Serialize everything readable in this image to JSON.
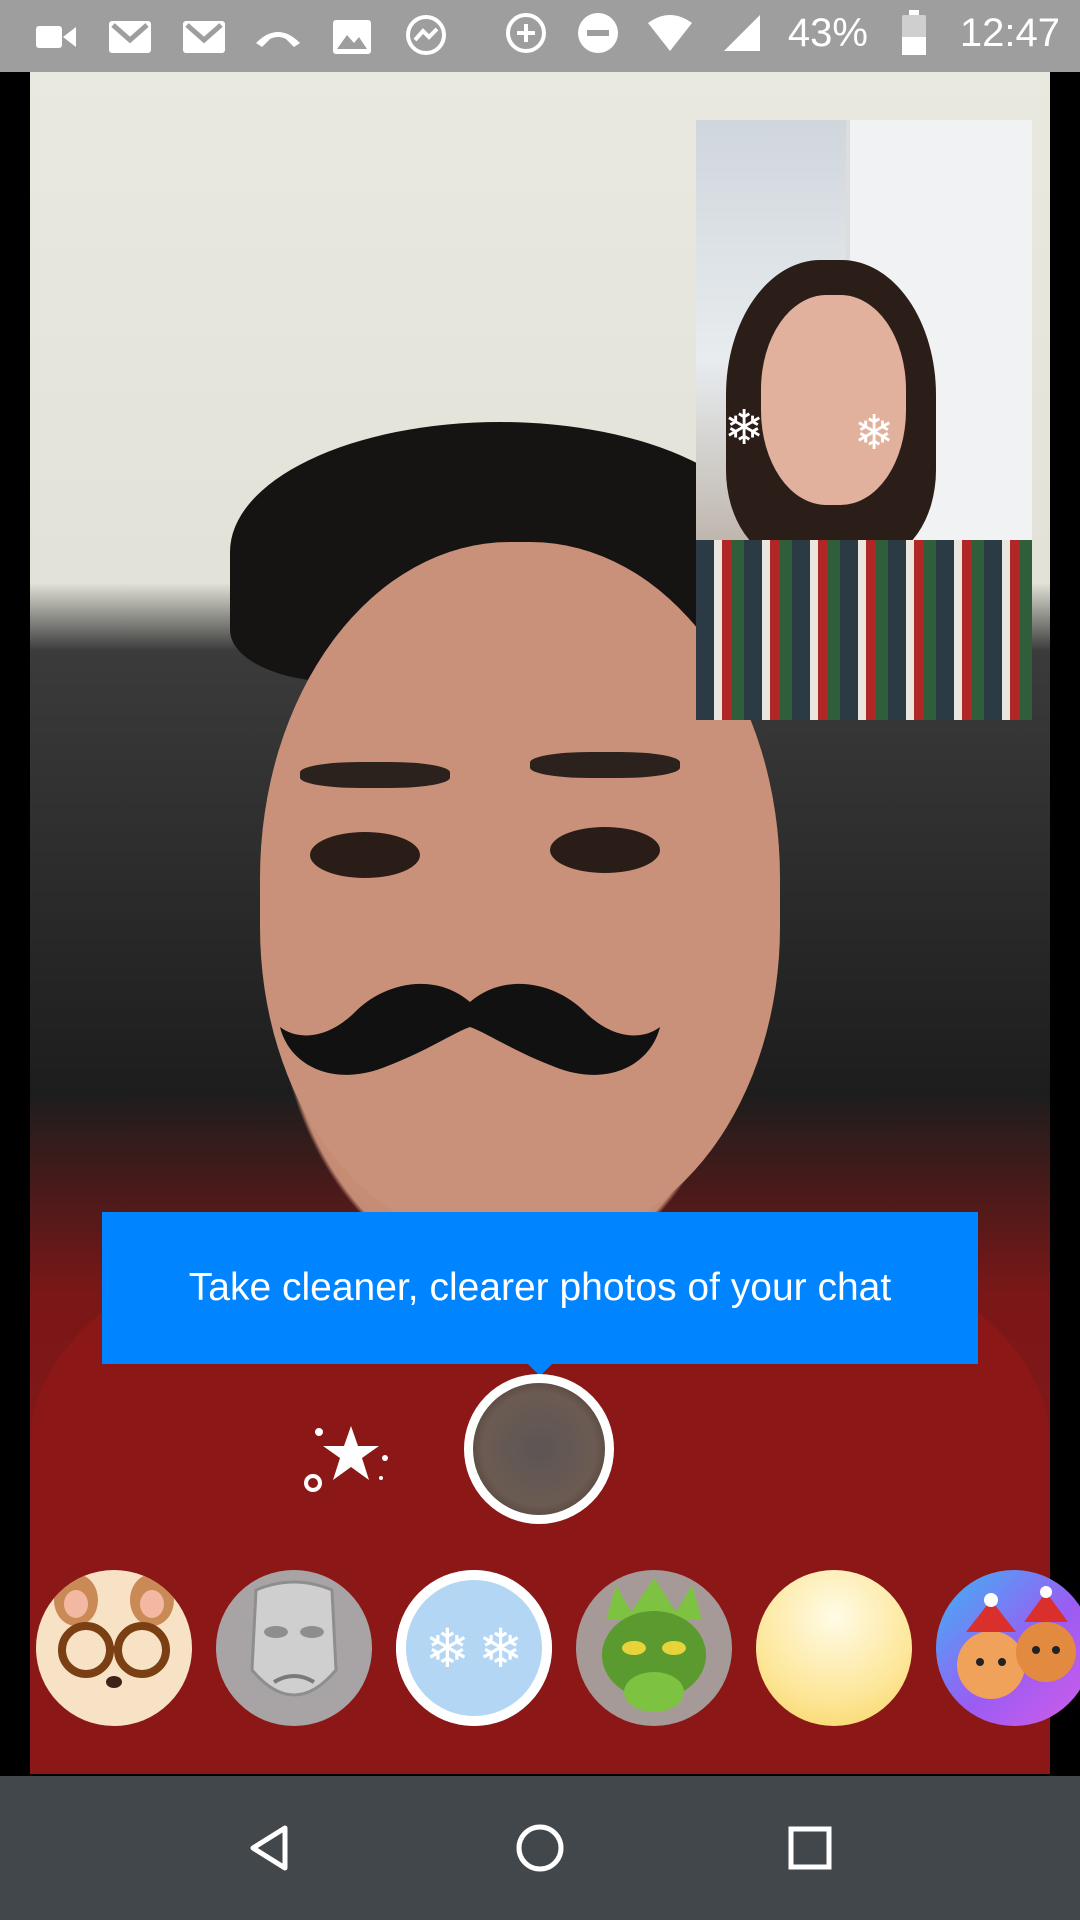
{
  "status_bar": {
    "battery": "43%",
    "time": "12:47",
    "icons": [
      "video-icon",
      "gmail-icon",
      "gmail-icon",
      "call-icon",
      "image-icon",
      "messenger-icon",
      "data-saver-icon",
      "do-not-disturb-icon",
      "wifi-icon",
      "cell-signal-icon",
      "battery-icon"
    ]
  },
  "tooltip": {
    "text": "Take cleaner, clearer photos of your chat"
  },
  "controls": {
    "effects_icon": "sparkle-star-icon",
    "shutter_icon": "capture-button"
  },
  "filters": [
    {
      "name": "bear-glasses-filter"
    },
    {
      "name": "mask-filter"
    },
    {
      "name": "snowflake-filter",
      "selected": true
    },
    {
      "name": "dragon-filter"
    },
    {
      "name": "glow-filter"
    },
    {
      "name": "holiday-pets-filter"
    }
  ],
  "colors": {
    "accent": "#0084ff",
    "status_bar": "#9e9e9e",
    "nav_bar": "#42474c"
  },
  "nav": {
    "back_icon": "back-icon",
    "home_icon": "home-icon",
    "recents_icon": "recents-icon"
  }
}
